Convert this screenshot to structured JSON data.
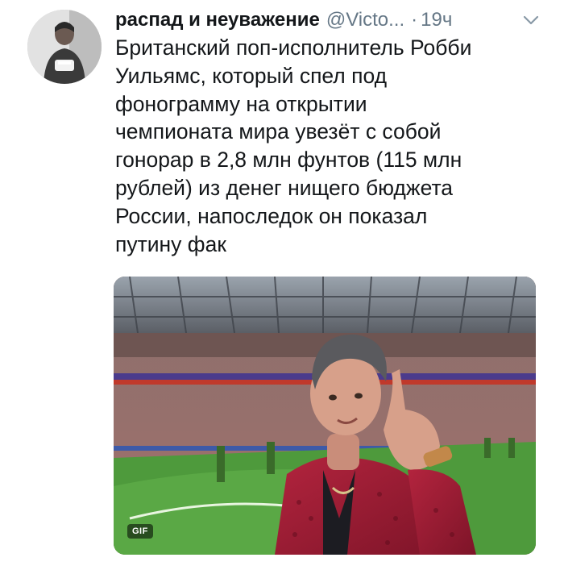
{
  "tweet": {
    "author_name": "распад и неуважение",
    "handle": "@Victo...",
    "separator": "·",
    "time": "19ч",
    "text": "Британский поп-исполнитель Робби\nУильямс, который спел под\nфонограмму на открытии\nчемпионата мира  увезёт с собой\nгонорар в 2,8 млн фунтов (115 млн\nрублей) из денег нищего бюджета\nРоссии, напоследок он показал\nпутину фак",
    "media_badge": "GIF",
    "more_icon": "chevron-down-icon",
    "avatar_icon": "user-avatar"
  },
  "colors": {
    "text_primary": "#14171a",
    "text_secondary": "#657786",
    "jacket": "#a01c35",
    "pitch": "#4e9a3c"
  }
}
